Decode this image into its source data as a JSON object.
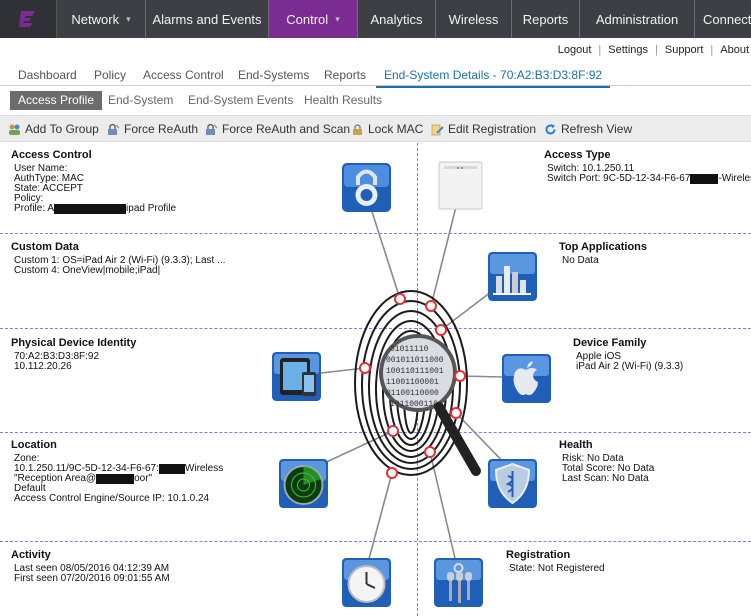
{
  "nav": {
    "items": [
      {
        "label": "Network",
        "caret": "▾"
      },
      {
        "label": "Alarms and Events"
      },
      {
        "label": "Control",
        "caret": "▾"
      },
      {
        "label": "Analytics"
      },
      {
        "label": "Wireless"
      },
      {
        "label": "Reports"
      },
      {
        "label": "Administration"
      },
      {
        "label": "Connect"
      }
    ]
  },
  "util": {
    "logout": "Logout",
    "settings": "Settings",
    "support": "Support",
    "about": "About",
    "sep": "|"
  },
  "tabs": {
    "dashboard": "Dashboard",
    "policy": "Policy",
    "access_control": "Access Control",
    "end_systems": "End-Systems",
    "reports": "Reports",
    "end_system_details": "End-System Details - 70:A2:B3:D3:8F:92"
  },
  "subtabs": {
    "access_profile": "Access Profile",
    "end_system": "End-System",
    "end_system_events": "End-System Events",
    "health_results": "Health Results"
  },
  "toolbar": {
    "add_to_group": "Add To Group",
    "force_reauth": "Force ReAuth",
    "force_reauth_scan": "Force ReAuth and Scan",
    "lock_mac": "Lock MAC",
    "edit_registration": "Edit Registration",
    "refresh_view": "Refresh View"
  },
  "access_control": {
    "title": "Access Control",
    "user_name": "User Name:",
    "auth_type": "AuthType: MAC",
    "state": "State: ACCEPT",
    "policy": "Policy:",
    "profile_prefix": "Profile: A",
    "profile_suffix": "ipad Profile"
  },
  "access_type": {
    "title": "Access Type",
    "switch": "Switch: 10.1.250.11",
    "switch_port_prefix": "Switch Port: 9C-5D-12-34-F6-67",
    "switch_port_suffix": "-Wireless"
  },
  "custom_data": {
    "title": "Custom Data",
    "custom1": "Custom 1: OS=iPad Air 2 (Wi-Fi) (9.3.3); Last ...",
    "custom4": "Custom 4: OneView|mobile;iPad|"
  },
  "top_applications": {
    "title": "Top Applications",
    "value": "No Data"
  },
  "physical_identity": {
    "title": "Physical Device Identity",
    "mac": "70:A2:B3:D3:8F:92",
    "ip": "10.112.20.26"
  },
  "device_family": {
    "title": "Device Family",
    "family": "Apple iOS",
    "model": "iPad Air 2 (Wi-Fi) (9.3.3)"
  },
  "location": {
    "title": "Location",
    "zone": "Zone:",
    "line1_prefix": "10.1.250.11/9C-5D-12-34-F6-67:",
    "line1_suffix": "Wireless",
    "line2_prefix": "\"Reception Area@",
    "line2_suffix": "oor\"",
    "line3": "Default",
    "line4": "Access Control Engine/Source IP: 10.1.0.24"
  },
  "health": {
    "title": "Health",
    "risk": "Risk: No Data",
    "total_score": "Total Score: No Data",
    "last_scan": "Last Scan: No Data"
  },
  "activity": {
    "title": "Activity",
    "last_seen": "Last seen 08/05/2016 04:12:39 AM",
    "first_seen": "First seen 07/20/2016 09:01:55 AM"
  },
  "registration": {
    "title": "Registration",
    "state": "State: Not Registered"
  },
  "icons": {
    "lock": "lock-icon",
    "access_point": "access-point-icon",
    "apps": "bar-chart-icon",
    "ipad": "ipad-devices-icon",
    "apple": "apple-icon",
    "radar": "radar-icon",
    "health": "health-shield-icon",
    "clock": "clock-icon",
    "keys": "keys-icon",
    "fingerprint": "fingerprint-magnifier-icon"
  },
  "colors": {
    "nav_bg": "#3d3f44",
    "nav_active": "#7b2c93",
    "tab_active": "#1e6fa8",
    "divider": "#7b7fe0",
    "node": "#e0303a"
  }
}
